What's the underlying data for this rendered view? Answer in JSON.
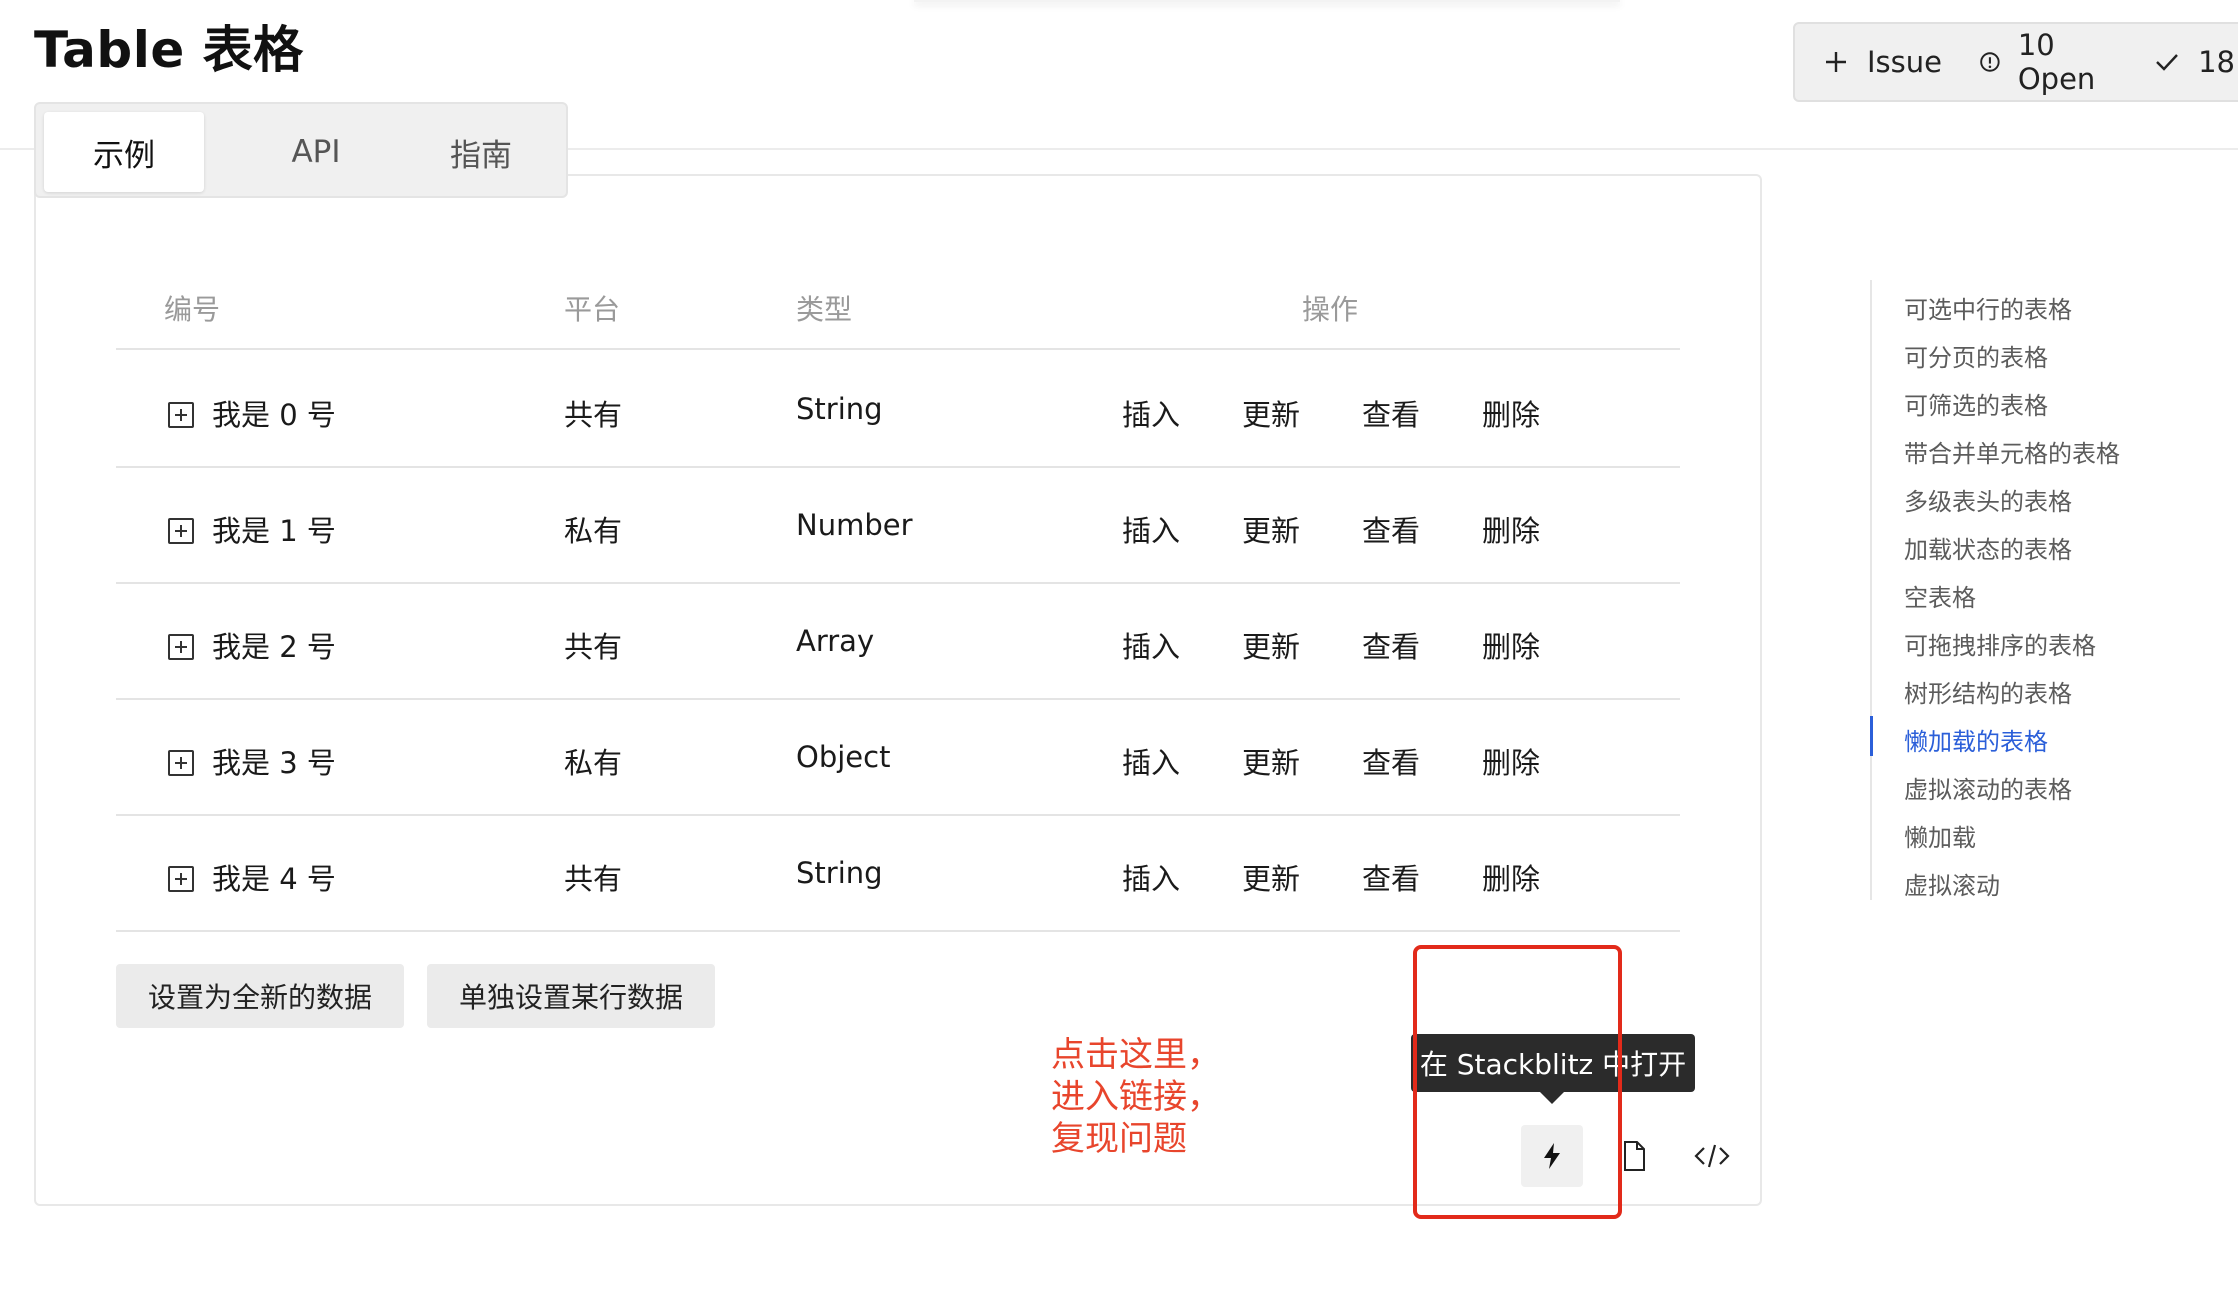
{
  "page": {
    "title": "Table 表格"
  },
  "issue_bar": {
    "add_label": "Issue",
    "open_label": "10 Open",
    "closed_label": "18"
  },
  "tabs": [
    {
      "label": "示例",
      "active": true
    },
    {
      "label": "API",
      "active": false
    },
    {
      "label": "指南",
      "active": false
    }
  ],
  "table": {
    "headers": [
      "编号",
      "平台",
      "类型",
      "操作"
    ],
    "rows": [
      {
        "name": "我是 0 号",
        "platform": "共有",
        "type": "String"
      },
      {
        "name": "我是 1 号",
        "platform": "私有",
        "type": "Number"
      },
      {
        "name": "我是 2 号",
        "platform": "共有",
        "type": "Array"
      },
      {
        "name": "我是 3 号",
        "platform": "私有",
        "type": "Object"
      },
      {
        "name": "我是 4 号",
        "platform": "共有",
        "type": "String"
      }
    ],
    "actions": [
      "插入",
      "更新",
      "查看",
      "删除"
    ]
  },
  "buttons": {
    "set_all": "设置为全新的数据",
    "set_row": "单独设置某行数据"
  },
  "annotation": [
    "点击这里，",
    "进入链接，",
    "复现问题"
  ],
  "tooltip": "在 Stackblitz 中打开",
  "toc": {
    "items": [
      "可选中行的表格",
      "可分页的表格",
      "可筛选的表格",
      "带合并单元格的表格",
      "多级表头的表格",
      "加载状态的表格",
      "空表格",
      "可拖拽排序的表格",
      "树形结构的表格",
      "懒加载的表格",
      "虚拟滚动的表格",
      "懒加载",
      "虚拟滚动"
    ],
    "active_index": 9
  },
  "colors": {
    "accent": "#2b5fd9",
    "annotation": "#e8452c",
    "highlight_box": "#e22a1a"
  }
}
